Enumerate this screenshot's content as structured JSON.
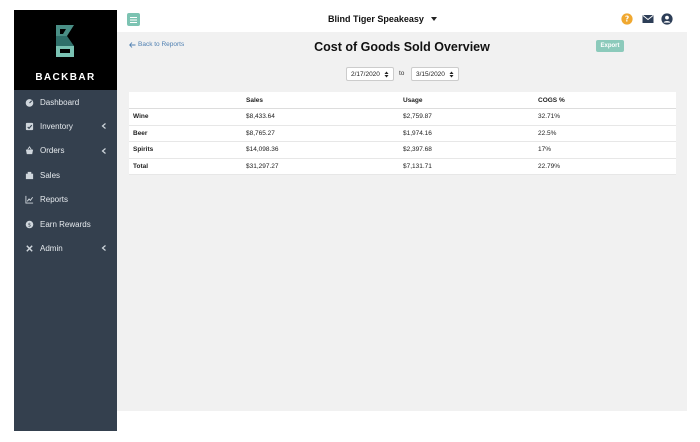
{
  "brand": {
    "name": "BACKBAR",
    "logo_icon": "backbar-logo-icon"
  },
  "sidebar": {
    "items": [
      {
        "label": "Dashboard",
        "icon": "dashboard-icon",
        "has_submenu": false
      },
      {
        "label": "Inventory",
        "icon": "inventory-icon",
        "has_submenu": true
      },
      {
        "label": "Orders",
        "icon": "basket-icon",
        "has_submenu": true
      },
      {
        "label": "Sales",
        "icon": "sales-icon",
        "has_submenu": false
      },
      {
        "label": "Reports",
        "icon": "chart-icon",
        "has_submenu": false
      },
      {
        "label": "Earn Rewards",
        "icon": "rewards-icon",
        "has_submenu": false
      },
      {
        "label": "Admin",
        "icon": "tools-icon",
        "has_submenu": true
      }
    ]
  },
  "header": {
    "venue_name": "Blind Tiger Speakeasy",
    "icons": [
      "help-icon",
      "mail-icon",
      "user-icon"
    ]
  },
  "main": {
    "back_link": "Back to Reports",
    "title": "Cost of Goods Sold Overview",
    "export_label": "Export",
    "date_from": "2/17/2020",
    "date_to": "3/15/2020",
    "date_separator": "to",
    "table": {
      "headers": [
        "",
        "Sales",
        "Usage",
        "COGS %"
      ],
      "rows": [
        [
          "Wine",
          "$8,433.64",
          "$2,759.87",
          "32.71%"
        ],
        [
          "Beer",
          "$8,765.27",
          "$1,974.16",
          "22.5%"
        ],
        [
          "Spirits",
          "$14,098.36",
          "$2,397.68",
          "17%"
        ],
        [
          "Total",
          "$31,297.27",
          "$7,131.71",
          "22.79%"
        ]
      ]
    }
  },
  "colors": {
    "sidebar_bg": "#34404e",
    "brand_bg": "#000000",
    "accent": "#7cc3b2",
    "help_icon": "#f0a830",
    "icon_dark": "#2d3e57",
    "link": "#4e7fb1"
  }
}
